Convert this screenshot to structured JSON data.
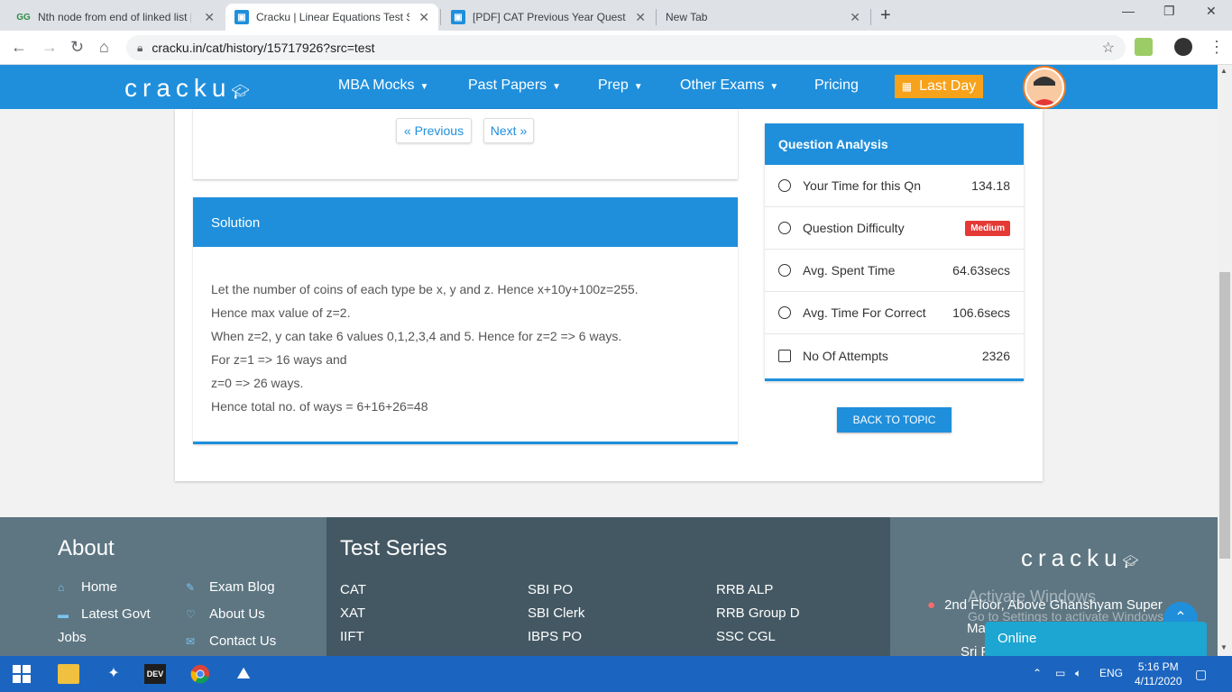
{
  "browser": {
    "tabs": [
      {
        "title": "Nth node from end of linked list |",
        "favicon": "GG"
      },
      {
        "title": "Cracku | Linear Equations Test So",
        "favicon": "cracku"
      },
      {
        "title": "[PDF] CAT Previous Year Questior",
        "favicon": "cracku"
      },
      {
        "title": "New Tab",
        "favicon": ""
      }
    ],
    "url": "cracku.in/cat/history/15717926?src=test"
  },
  "site": {
    "logo": "cracku",
    "nav": [
      "MBA Mocks",
      "Past Papers",
      "Prep",
      "Other Exams",
      "Pricing"
    ],
    "last_day": "Last Day"
  },
  "pager": {
    "previous": "« Previous",
    "next": "Next »"
  },
  "solution": {
    "heading": "Solution",
    "lines": [
      "Let the number of coins of each type be x, y and z. Hence x+10y+100z=255.",
      "Hence max value of z=2.",
      "When z=2, y can take 6 values 0,1,2,3,4 and 5. Hence for z=2 => 6 ways.",
      "For z=1 => 16 ways and",
      "z=0 => 26 ways.",
      "Hence total no. of ways = 6+16+26=48"
    ]
  },
  "analysis": {
    "heading": "Question Analysis",
    "rows": [
      {
        "label": "Your Time for this Qn",
        "value": "134.18",
        "icon": "stopwatch-icon"
      },
      {
        "label": "Question Difficulty",
        "value": "Medium",
        "icon": "question-circle-icon"
      },
      {
        "label": "Avg. Spent Time",
        "value": "64.63secs",
        "icon": "clock-icon"
      },
      {
        "label": "Avg. Time For Correct",
        "value": "106.6secs",
        "icon": "alarm-clock-icon"
      },
      {
        "label": "No Of Attempts",
        "value": "2326",
        "icon": "edit-icon"
      }
    ],
    "back_button": "BACK TO TOPIC"
  },
  "footer": {
    "about_heading": "About",
    "about_links": [
      "Home",
      "Exam Blog",
      "Latest Govt",
      "About Us",
      "Jobs",
      "Contact Us"
    ],
    "test_series_heading": "Test Series",
    "test_series": [
      "CAT",
      "SBI PO",
      "RRB ALP",
      "XAT",
      "SBI Clerk",
      "RRB Group D",
      "IIFT",
      "IBPS PO",
      "SSC CGL"
    ],
    "logo": "cracku",
    "address": "2nd Floor, Above Ghanshyam Super",
    "address_line2": "Ma",
    "address_line3": "Sri F",
    "watermark_title": "Activate Windows",
    "watermark_sub": "Go to Settings to activate Windows.",
    "online": "Online"
  },
  "taskbar": {
    "lang": "ENG",
    "time": "5:16 PM",
    "date": "4/11/2020"
  },
  "colors": {
    "accent": "#1f8fdc",
    "orange": "#f7a21b",
    "footer": "#5d7682",
    "footer_dark": "#445863"
  }
}
